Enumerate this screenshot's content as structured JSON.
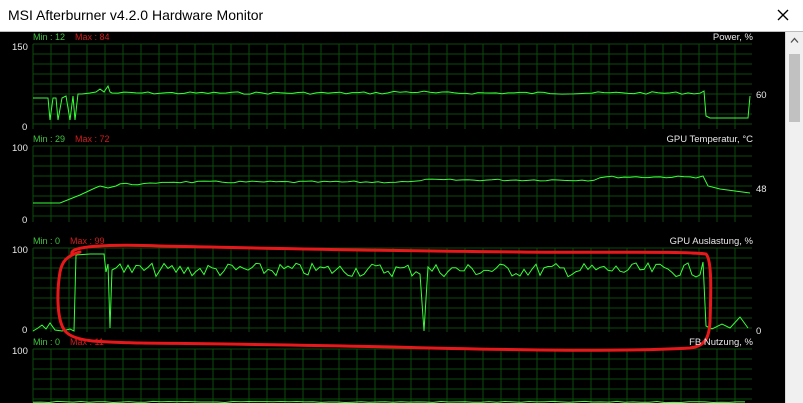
{
  "window": {
    "title": "MSI Afterburner v4.2.0 Hardware Monitor",
    "close_icon": "close-icon"
  },
  "colors": {
    "grid": "#0b4a0b",
    "trace": "#38ff38",
    "annotation": "#e8181a",
    "background": "#000000"
  },
  "graphs": [
    {
      "name": "Power, %",
      "min_label": "Min : 12",
      "max_label": "Max : 84",
      "y_top": "150",
      "y_bottom": "0",
      "current": "60"
    },
    {
      "name": "GPU Temperatur, °C",
      "min_label": "Min : 29",
      "max_label": "Max : 72",
      "y_top": "100",
      "y_bottom": "0",
      "current": "48"
    },
    {
      "name": "GPU Auslastung, %",
      "min_label": "Min : 0",
      "max_label": "Max : 99",
      "y_top": "100",
      "y_bottom": "0",
      "current": "0"
    },
    {
      "name": "FB Nutzung, %",
      "min_label": "Min : 0",
      "max_label": "Max : 11",
      "y_top": "100",
      "y_bottom": "",
      "current": ""
    }
  ]
}
